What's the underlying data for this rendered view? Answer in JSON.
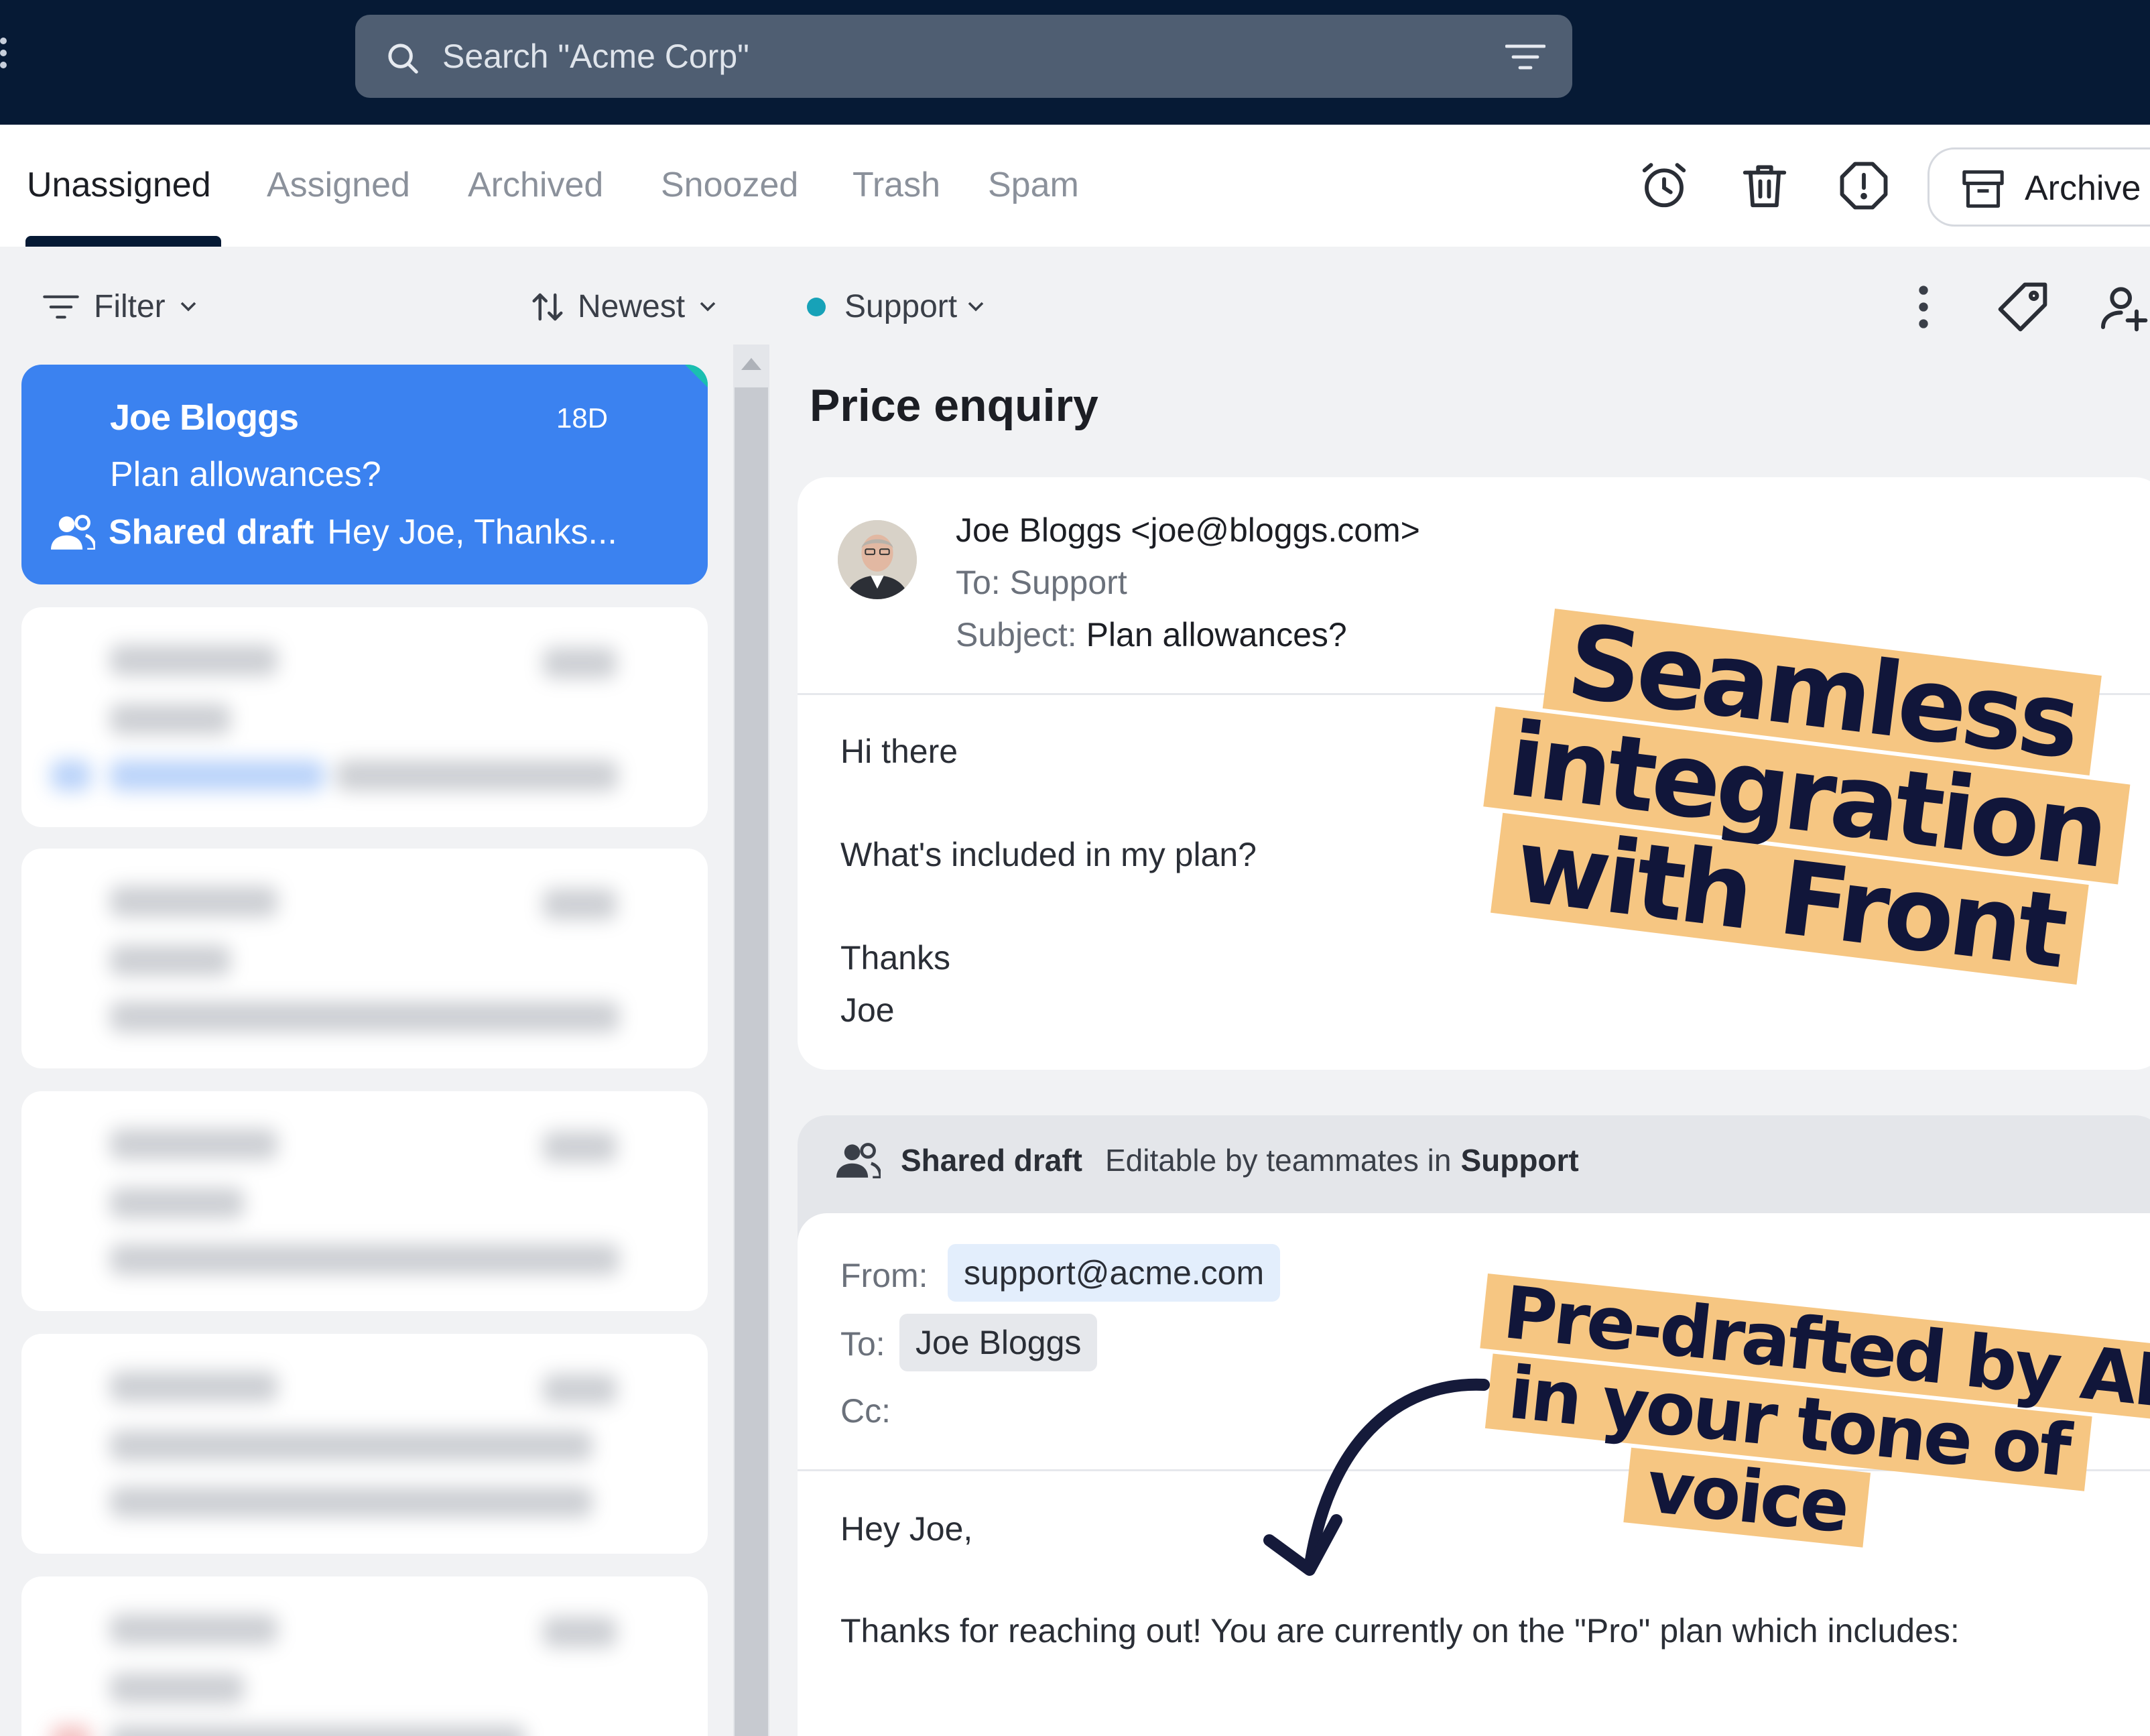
{
  "search": {
    "placeholder": "Search \"Acme Corp\""
  },
  "tabs": [
    {
      "label": "Unassigned",
      "active": true
    },
    {
      "label": "Assigned"
    },
    {
      "label": "Archived"
    },
    {
      "label": "Snoozed"
    },
    {
      "label": "Trash"
    },
    {
      "label": "Spam"
    }
  ],
  "toolbar": {
    "icons": [
      "alarm-clock-icon",
      "trash-icon",
      "spam-alert-icon"
    ],
    "archive_label": "Archive"
  },
  "list_controls": {
    "filter_label": "Filter",
    "sort_label": "Newest"
  },
  "inbox_selector": {
    "label": "Support",
    "color": "#17a2b8"
  },
  "conversations": [
    {
      "name": "Joe Bloggs",
      "date": "18D",
      "subject": "Plan allowances?",
      "preview_label": "Shared draft",
      "preview_text": "Hey Joe, Thanks..."
    }
  ],
  "conversation": {
    "title": "Price enquiry",
    "message": {
      "sender_name": "Joe Bloggs",
      "sender_email": "<joe@bloggs.com>",
      "to_line": "To: Support",
      "subject_label": "Subject:",
      "subject": "Plan allowances?",
      "body": [
        "Hi there",
        "What's included in my plan?",
        "Thanks",
        "Joe"
      ]
    },
    "draft": {
      "label": "Shared draft",
      "editable_text": "Editable by teammates in",
      "team": "Support",
      "from_label": "From:",
      "from": "support@acme.com",
      "to_label": "To:",
      "to": "Joe Bloggs",
      "cc_label": "Cc:",
      "body": [
        "Hey Joe,",
        "Thanks for reaching out! You are currently on the \"Pro\" plan which includes:"
      ]
    }
  },
  "callouts": {
    "integration": [
      "Seamless",
      "integration",
      "with Front"
    ],
    "ai": [
      "Pre-drafted by AI",
      "in your tone of",
      "voice"
    ]
  },
  "colors": {
    "accent": "#3b82f0",
    "topbar": "#061a35",
    "highlight": "#f6c682"
  }
}
